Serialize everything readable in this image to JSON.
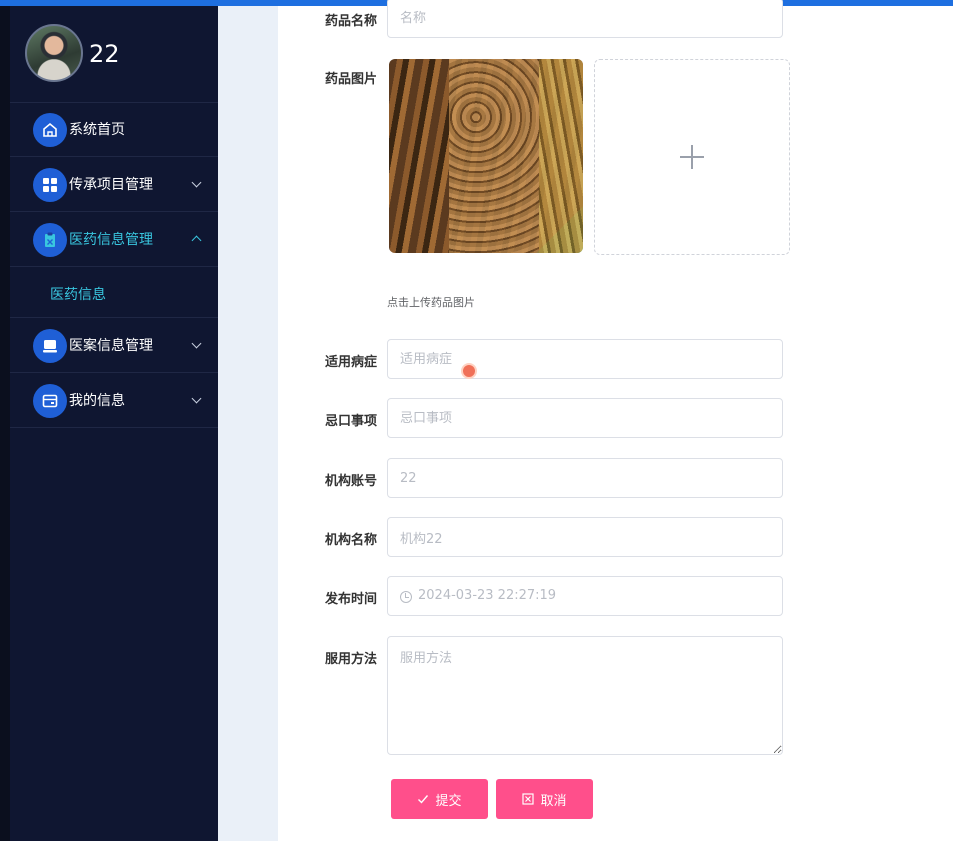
{
  "profile": {
    "name": "22"
  },
  "menu": [
    {
      "label": "系统首页",
      "icon": "home-icon"
    },
    {
      "label": "传承项目管理",
      "icon": "grid-icon"
    },
    {
      "label": "医药信息管理",
      "icon": "clipboard-icon",
      "expanded": true
    },
    {
      "label": "医案信息管理",
      "icon": "monitor-icon"
    },
    {
      "label": "我的信息",
      "icon": "wallet-icon"
    }
  ],
  "submenu": {
    "label": "医药信息"
  },
  "form": {
    "name": {
      "label": "药品名称",
      "placeholder": "名称"
    },
    "image": {
      "label": "药品图片",
      "tip": "点击上传药品图片"
    },
    "indication": {
      "label": "适用病症",
      "placeholder": "适用病症"
    },
    "taboo": {
      "label": "忌口事项",
      "placeholder": "忌口事项"
    },
    "org_account": {
      "label": "机构账号",
      "value": "22"
    },
    "org_name": {
      "label": "机构名称",
      "value": "机构22"
    },
    "publish_time": {
      "label": "发布时间",
      "value": "2024-03-23 22:27:19"
    },
    "usage": {
      "label": "服用方法",
      "placeholder": "服用方法"
    }
  },
  "buttons": {
    "submit": "提交",
    "cancel": "取消"
  },
  "colors": {
    "accent": "#ff4f8b",
    "sidebar": "#0f1631",
    "active": "#39c6df",
    "topbar": "#1e6fe0"
  }
}
